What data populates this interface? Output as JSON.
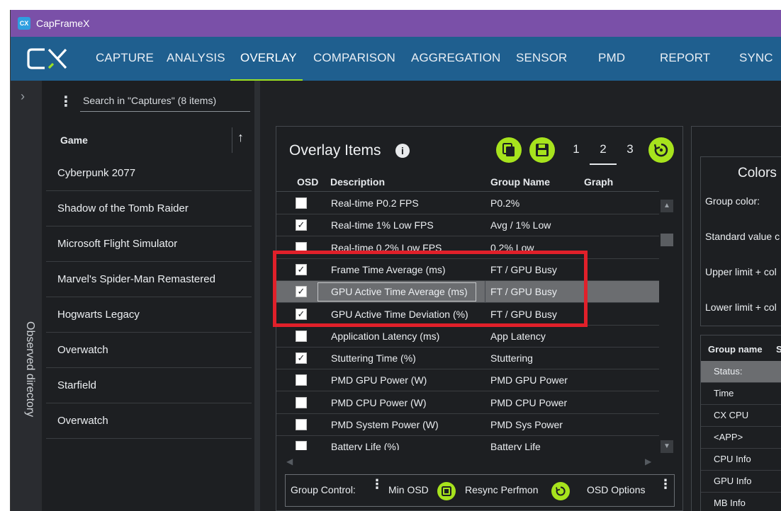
{
  "window": {
    "title": "CapFrameX",
    "icon_label": "CX"
  },
  "nav": {
    "items": [
      "CAPTURE",
      "ANALYSIS",
      "OVERLAY",
      "COMPARISON",
      "AGGREGATION",
      "SENSOR",
      "PMD",
      "REPORT",
      "SYNC"
    ],
    "active": "OVERLAY",
    "accent_color": "#9be024"
  },
  "side_strip": {
    "label": "Observed directory"
  },
  "captures": {
    "search_placeholder": "Search in \"Captures\" (8 items)",
    "header": "Game",
    "items": [
      "Cyberpunk 2077",
      "Shadow of the Tomb Raider",
      "Microsoft Flight Simulator",
      "Marvel's Spider-Man Remastered",
      "Hogwarts Legacy",
      "Overwatch",
      "Starfield",
      "Overwatch"
    ]
  },
  "overlay": {
    "title": "Overlay Items",
    "pages": [
      "1",
      "2",
      "3"
    ],
    "active_page": "2",
    "columns": {
      "osd": "OSD",
      "description": "Description",
      "group": "Group Name",
      "graph": "Graph"
    },
    "rows": [
      {
        "checked": false,
        "description": "Real-time P0.2 FPS",
        "group": "P0.2%"
      },
      {
        "checked": true,
        "description": "Real-time 1% Low FPS",
        "group": "Avg / 1% Low"
      },
      {
        "checked": false,
        "description": "Real-time 0.2% Low FPS",
        "group": "0.2% Low"
      },
      {
        "checked": true,
        "description": "Frame Time Average (ms)",
        "group": "FT / GPU Busy"
      },
      {
        "checked": true,
        "description": "GPU Active Time Average (ms)",
        "group": "FT / GPU Busy",
        "selected": true
      },
      {
        "checked": true,
        "description": "GPU Active Time Deviation (%)",
        "group": "FT / GPU Busy"
      },
      {
        "checked": false,
        "description": "Application Latency (ms)",
        "group": "App Latency"
      },
      {
        "checked": true,
        "description": "Stuttering Time (%)",
        "group": "Stuttering"
      },
      {
        "checked": false,
        "description": "PMD GPU Power (W)",
        "group": "PMD GPU Power"
      },
      {
        "checked": false,
        "description": "PMD CPU Power (W)",
        "group": "PMD CPU Power"
      },
      {
        "checked": false,
        "description": "PMD System Power (W)",
        "group": "PMD Sys Power"
      },
      {
        "checked": false,
        "description": "Battery Life (%)",
        "group": "Battery Life"
      }
    ],
    "group_control": {
      "label": "Group Control:",
      "min_osd": "Min OSD",
      "resync": "Resync Perfmon",
      "osd_options": "OSD Options"
    },
    "highlight_color": "#e0202a",
    "button_color": "#a7e31d"
  },
  "colors_panel": {
    "title": "Colors",
    "labels": [
      "Group color:",
      "Standard value c",
      "Upper limit + col",
      "Lower limit + col"
    ]
  },
  "groups_panel": {
    "header": "Group name",
    "header2": "S",
    "items": [
      "Status:",
      "Time",
      "CX CPU",
      "<APP>",
      "CPU Info",
      "GPU Info",
      "MB Info"
    ]
  }
}
